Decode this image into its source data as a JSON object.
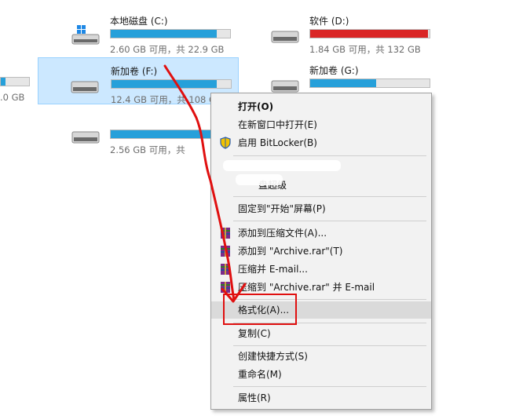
{
  "drives": [
    {
      "name": "本地磁盘 (C:)",
      "size": "2.60 GB 可用，共 22.9 GB",
      "fill": 0.89,
      "color": "#26a0da",
      "icon": "windows-drive-icon"
    },
    {
      "name": "软件 (D:)",
      "size": "1.84 GB 可用，共 132 GB",
      "fill": 0.99,
      "color": "#da2626",
      "icon": "hard-drive-icon"
    },
    {
      "name": "新加卷 (F:)",
      "size": "12.4 GB 可用，共 108 GB",
      "fill": 0.88,
      "color": "#26a0da",
      "icon": "hard-drive-icon",
      "selected": true
    },
    {
      "name": "新加卷 (G:)",
      "size": "",
      "fill": 0.55,
      "color": "#26a0da",
      "icon": "hard-drive-icon"
    },
    {
      "name": "",
      "size": "2.56 GB 可用，共",
      "fill": 0.9,
      "color": "#26a0da",
      "icon": "hard-drive-icon"
    }
  ],
  "partial_left_size": ".0 GB",
  "menu": {
    "items": [
      {
        "label": "打开(O)",
        "bold": true
      },
      {
        "label": "在新窗口中打开(E)"
      },
      {
        "label": "启用 BitLocker(B)",
        "icon": "shield-icon"
      },
      {
        "label": ""
      },
      {
        "label": "盘超级"
      },
      {
        "label": "固定到\"开始\"屏幕(P)"
      },
      {
        "label": "添加到压缩文件(A)...",
        "icon": "winrar-icon"
      },
      {
        "label": "添加到 \"Archive.rar\"(T)",
        "icon": "winrar-icon"
      },
      {
        "label": "压缩并 E-mail...",
        "icon": "winrar-icon"
      },
      {
        "label": "压缩到 \"Archive.rar\" 并 E-mail",
        "icon": "winrar-icon"
      },
      {
        "label": "格式化(A)...",
        "highlighted": true
      },
      {
        "label": "复制(C)"
      },
      {
        "label": "创建快捷方式(S)"
      },
      {
        "label": "重命名(M)"
      },
      {
        "label": "属性(R)"
      }
    ]
  },
  "colors": {
    "selection": "#cce8ff",
    "accent": "#26a0da",
    "warning": "#da2626",
    "annotation": "#e01010"
  }
}
